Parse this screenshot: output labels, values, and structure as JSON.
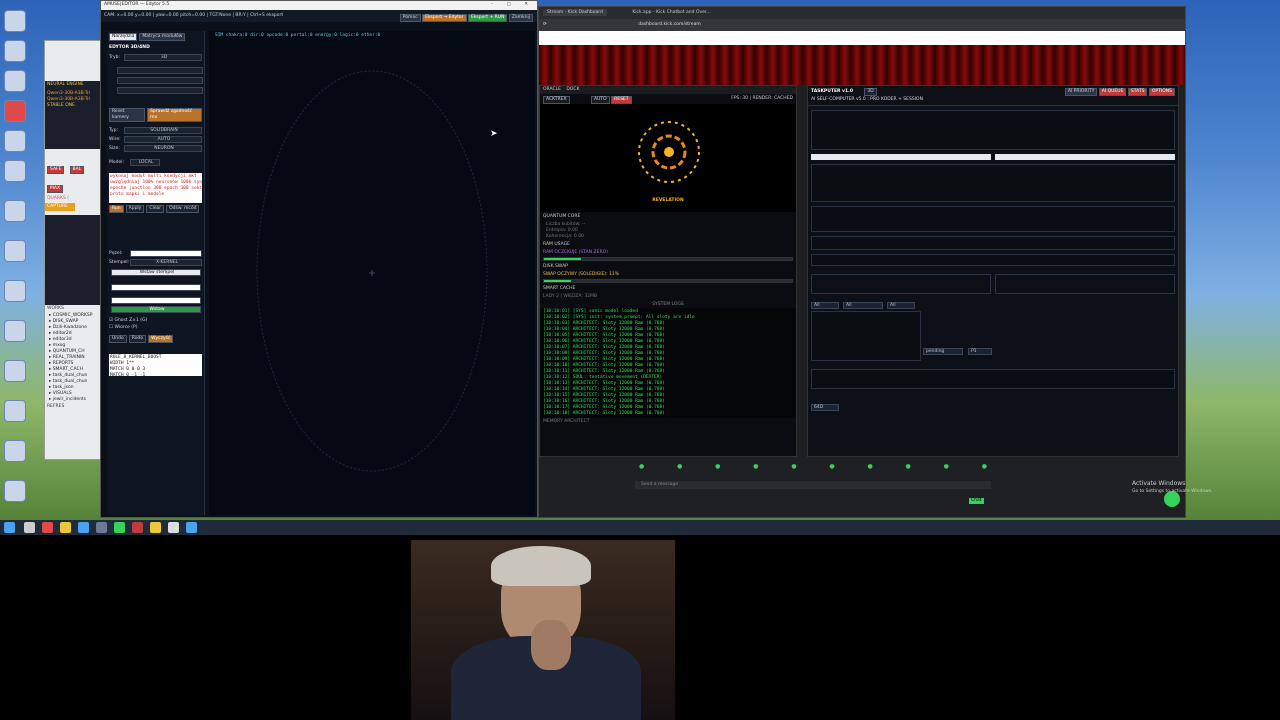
{
  "editor_window": {
    "title": "AMUSE|EDITOR — Edytor 5.5",
    "status_line": "CAM: x=0.00 y=0.00 | yaw=0.00 pitch=0.00 | TGT:None | BR:Y | Ctrl+S eksport",
    "top_buttons": [
      "Pomoc",
      "Eksport → Edytor",
      "Eksport + RUN",
      "Zamknij"
    ],
    "tabs": [
      "Narzędzia",
      "Matryca modułów"
    ],
    "panel_title": "EDYTOR 3D/4ND",
    "mode_label": "Tryb:",
    "mode_value": "3D",
    "reset_camera": "Reset kamery",
    "check_sequence": "Sprawdź zgodność mx",
    "type_label": "Typ:",
    "type_value": "SOLIDBRAIN",
    "wire_label": "Wire:",
    "wire_value": "AUTO",
    "size_label": "Size:",
    "size_value": "NEURON",
    "model_label": "Model:",
    "model_value": "LOCAL",
    "console_text": "wykonaj moduł multi kondycji mkt\nuwzględniaj 100% neuronów 100k syn\nepoche junction 300 epoch 300 sekt\nproto mapki i modele",
    "console_buttons": [
      "Run",
      "Apply",
      "Clear",
      "Odśw. mcód"
    ],
    "search_label": "Pęzel:",
    "stamp_label": "Stempel:",
    "stamp_value": "X-KERNEL",
    "stamp_button": "Wstaw stempel",
    "insert_button": "Wstaw",
    "ghost_check": "Ghost Z±1 (G)",
    "wire_check": "Wiorce (P)",
    "undo_buttons": [
      "Undo",
      "Redo",
      "Wyczyść"
    ],
    "bottom_text": "RULE_8_KERNEL_BOOST\nWIDTH 1**\nMATCH 0 0 0 3\nMATCH 0 -1 -1",
    "canvas_status": "SIM chakra:0 dir:0 opcode:0 portal:0 energy:0 logic:0 ether:0"
  },
  "back_window": {
    "neural_label": "NEURAL ENGINE",
    "models": [
      "Qwen3-30B-A3B-Tri",
      "Qwen3-30B-A3B-Tri"
    ],
    "stable_label": "STABLE ONE",
    "capture": "CAPTURE",
    "buttons": [
      "SAFE",
      "BAL",
      "MAX"
    ],
    "quarks": "QUARKS (",
    "works_label": "WORKS",
    "tree": [
      "COSMIC_WORKSP",
      "DISK_SWAP",
      "Dzili-Kwadzone",
      "editor2d",
      "editor3d",
      "mxog",
      "QUANTUM_CH",
      "REAL_TRAININ",
      "REPORTS",
      "SMART_CACH",
      "task_dual_chun",
      "task_dual_chun",
      "task_json",
      "VISUALS",
      "jewir_incidents"
    ],
    "refresh": "REFRES"
  },
  "browser": {
    "tabs": [
      "Stream - Kick Dashboard",
      "Kick.app - Kick Chatbot and Over..."
    ],
    "url": "dashboard.kick.com/stream",
    "chat_placeholder": "Send a message",
    "chat_button": "Chat",
    "activate": "Activate Windows",
    "activate_sub": "Go to Settings to activate Windows."
  },
  "oracle_panel": {
    "tabs": [
      "ORACLE",
      "DOCK"
    ],
    "toolbar": [
      "ACKTREX",
      "AUTO",
      "RESET"
    ],
    "fps": "FPS: 30 | RENDER: CACHED",
    "logo_caption": "REVELATION",
    "sections": [
      "QUANTUM CORE",
      "RAM USAGE",
      "DISK SWAP",
      "SMART CACHE"
    ],
    "quantum_lines": [
      "Liczba kubitów: --",
      "Entropia: 0.00",
      "Koherencja: 0.00"
    ],
    "ram_label": "RAM OCZEKUJE (STAN ZERO)",
    "ram_fill": 0.15,
    "swap_label": "SWAP OCZYWY (SOLEDIGIE): 11%",
    "swap_fill": 0.11,
    "cache_label": "LADY 2 | WIĘDZA: 32MB",
    "logs_title": "SYSTEM LOGS",
    "logs": [
      "[10:10:01] [SYS] sanic model loaded",
      "[10:10:02] [SYS] init: system_prompt: All sloty are idle",
      "[10:10:03] ARCHITECT: Sloty 12000 Ram (0.768)",
      "[10:10:04] ARCHITECT: Sloty 12000 Ram (0.768)",
      "[10:10:05] ARCHITECT: Sloty 12000 Ram (0.768)",
      "[10:10:06] ARCHITECT: Sloty 12000 Ram (0.768)",
      "[10:10:07] ARCHITECT: Sloty 12000 Ram (0.768)",
      "[10:10:08] ARCHITECT: Sloty 12000 Ram (0.768)",
      "[10:10:09] ARCHITECT: Sloty 12000 Ram (0.768)",
      "[10:10:10] ARCHITECT: Sloty 12000 Ram (0.768)",
      "[10:10:11] ARCHITECT: Sloty 12000 Ram (0.768)",
      "[10:10:12] SOUL: tentative movement (DEXTER)",
      "[10:10:13] ARCHITECT: Sloty 12000 Ram (0.768)",
      "[10:10:14] ARCHITECT: Sloty 12000 Ram (0.768)",
      "[10:10:15] ARCHITECT: Sloty 12000 Ram (0.768)",
      "[10:10:16] ARCHITECT: Sloty 12000 Ram (0.768)",
      "[10:10:17] ARCHITECT: Sloty 12000 Ram (0.768)",
      "[10:10:18] ARCHITECT: Sloty 12000 Ram (0.768)"
    ],
    "footer": "MEMORY ARCHITECT"
  },
  "taskputer": {
    "title": "TASKPUTER v1.0",
    "subtitle": "AI SELF-COMPUTER v5.0 : PRO KODER + SESSION",
    "mode_value": "3D",
    "tabs": [
      "AI PRIORITY",
      "AI QUEUE",
      "STATS",
      "OPTIONS"
    ],
    "status_value": "pending",
    "priority_value": "P1",
    "filters": [
      "All",
      "All",
      "All"
    ],
    "bottom_value": "64D"
  },
  "webcam": {}
}
